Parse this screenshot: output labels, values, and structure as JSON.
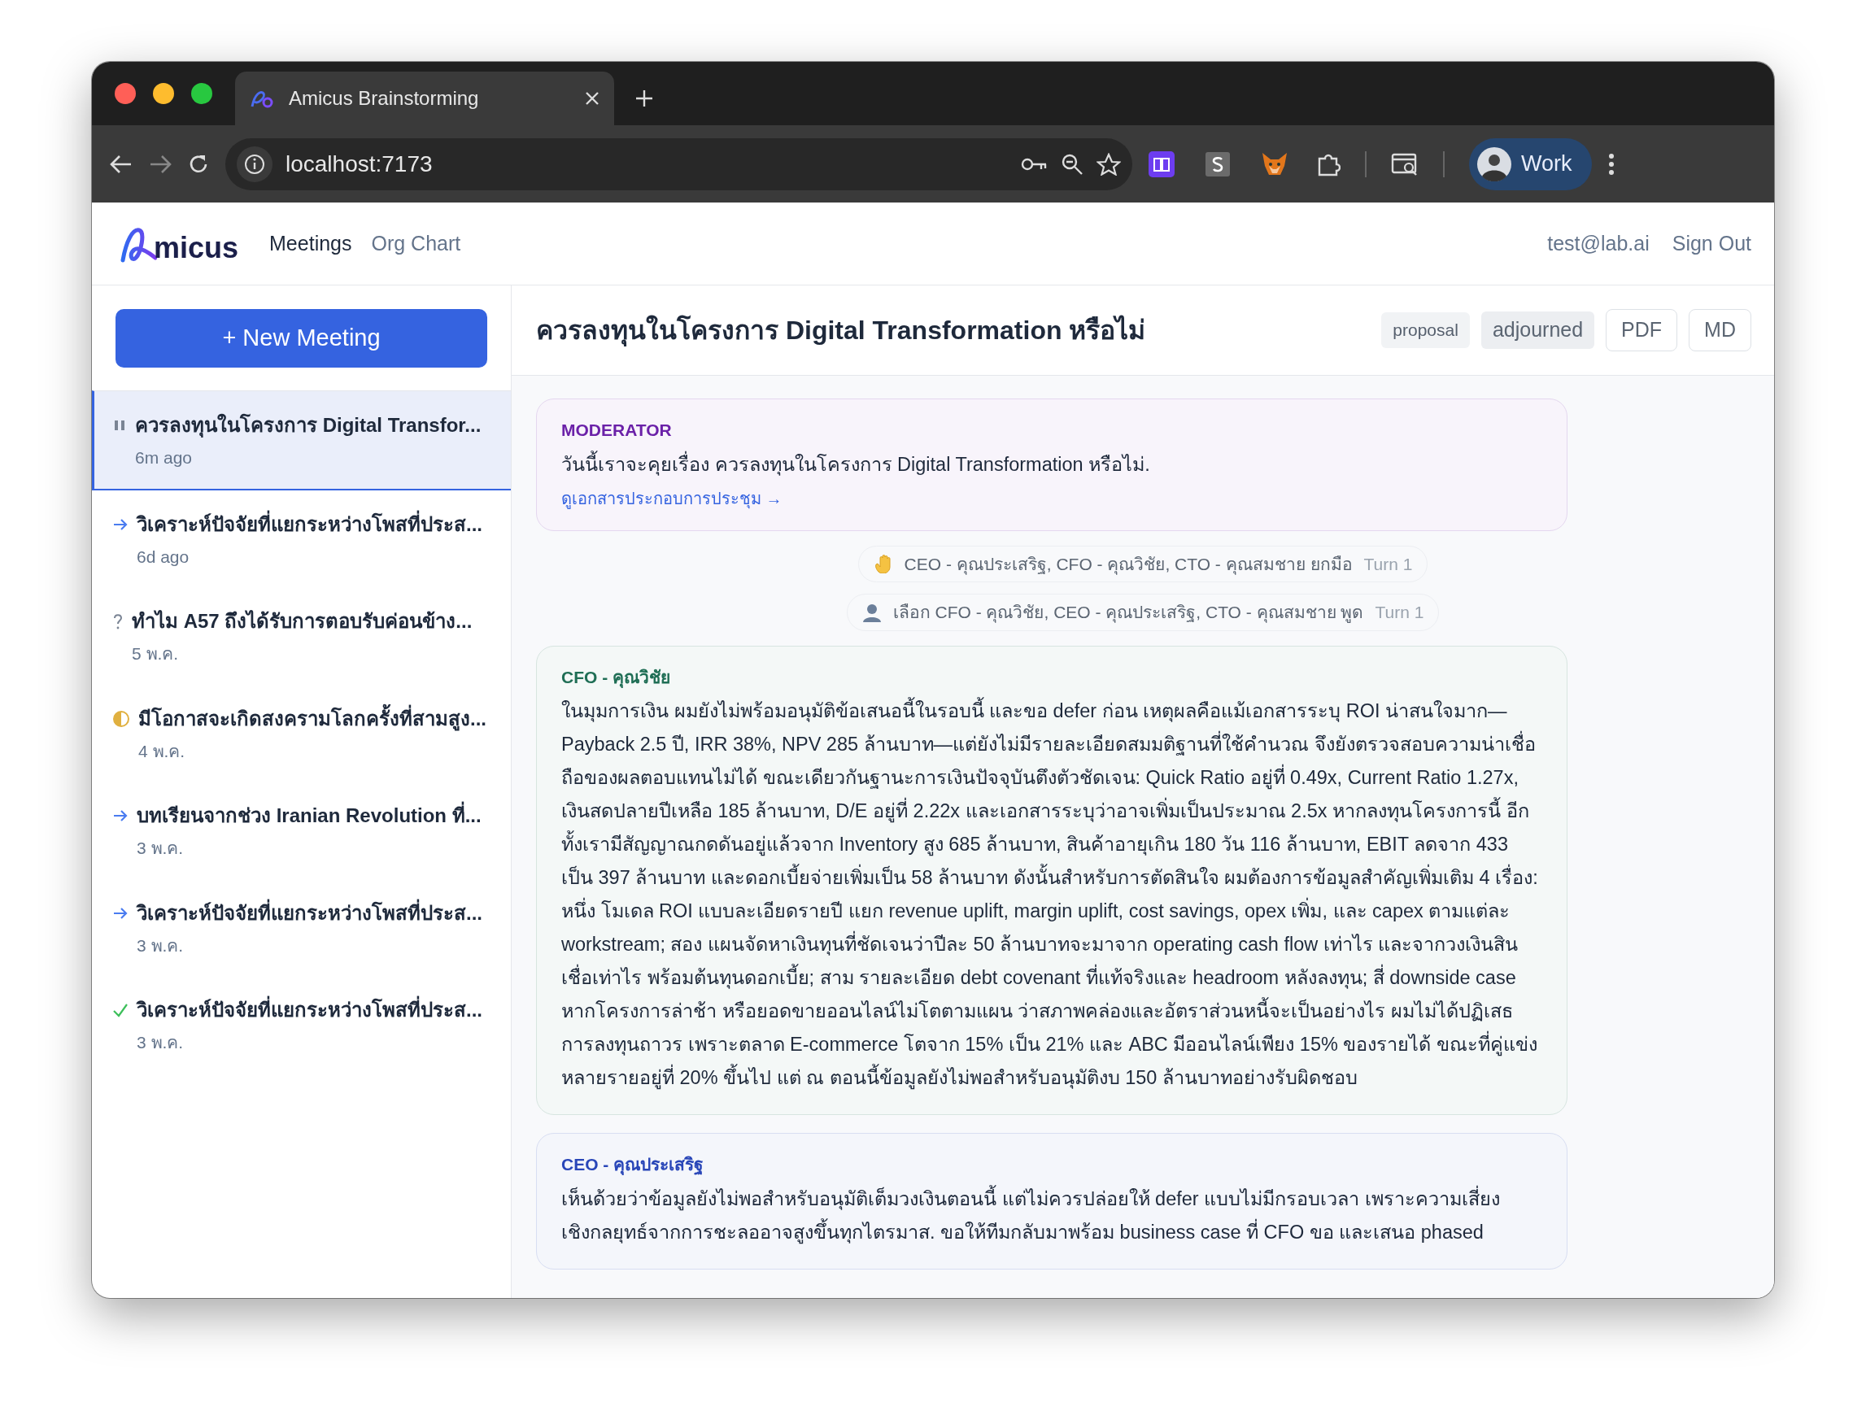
{
  "browser": {
    "tabs": [
      {
        "title": "Amicus Brainstorming",
        "selected": true
      }
    ],
    "url": "localhost:7173",
    "profile": "Work"
  },
  "app": {
    "logo_text": "micus",
    "nav": [
      {
        "label": "Meetings",
        "selected": true
      },
      {
        "label": "Org Chart",
        "selected": false
      }
    ],
    "user": "test@lab.ai",
    "sign_out": "Sign Out"
  },
  "sidebar": {
    "new_button": "+ New Meeting",
    "meetings": [
      {
        "title": "ควรลงทุนในโครงการ Digital Transfor...",
        "time": "6m ago",
        "kind": "paused",
        "selected": true
      },
      {
        "title": "วิเคราะห์ปัจจัยที่แยกระหว่างโพสที่ประส...",
        "time": "6d ago",
        "kind": "running",
        "selected": false
      },
      {
        "title": "ทำไม A57 ถึงได้รับการตอบรับค่อนข้าง...",
        "time": "5 พ.ค.",
        "kind": "question",
        "selected": false
      },
      {
        "title": "มีโอกาสจะเกิดสงครามโลกครั้งที่สามสูง...",
        "time": "4 พ.ค.",
        "kind": "partial",
        "selected": false
      },
      {
        "title": "บทเรียนจากช่วง Iranian Revolution ที่...",
        "time": "3 พ.ค.",
        "kind": "running",
        "selected": false
      },
      {
        "title": "วิเคราะห์ปัจจัยที่แยกระหว่างโพสที่ประส...",
        "time": "3 พ.ค.",
        "kind": "running",
        "selected": false
      },
      {
        "title": "วิเคราะห์ปัจจัยที่แยกระหว่างโพสที่ประส...",
        "time": "3 พ.ค.",
        "kind": "done",
        "selected": false
      }
    ]
  },
  "meeting": {
    "title": "ควรลงทุนในโครงการ Digital Transformation หรือไม่",
    "tags": [
      {
        "label": "proposal",
        "kind": "type"
      },
      {
        "label": "adjourned",
        "kind": "status"
      }
    ],
    "buttons": [
      "PDF",
      "MD"
    ],
    "messages": [
      {
        "kind": "speech",
        "speaker": "MODERATOR",
        "color": "#6b21a8",
        "text": "วันนี้เราจะคุยเรื่อง ควรลงทุนในโครงการ Digital Transformation หรือไม่.",
        "link": "ดูเอกสารประกอบการประชุม →"
      },
      {
        "kind": "hand_raise",
        "text": "CEO - คุณประเสริฐ, CFO - คุณวิชัย, CTO - คุณสมชาย ยกมือ",
        "turn": "Turn 1"
      },
      {
        "kind": "selection",
        "text": "เลือก CFO - คุณวิชัย, CEO - คุณประเสริฐ, CTO - คุณสมชาย พูด",
        "turn": "Turn 1"
      },
      {
        "kind": "speech",
        "speaker": "CFO - คุณวิชัย",
        "color": "#1f6e55",
        "text": "ในมุมการเงิน ผมยังไม่พร้อมอนุมัติข้อเสนอนี้ในรอบนี้ และขอ defer ก่อน เหตุผลคือแม้เอกสารระบุ ROI น่าสนใจมาก—Payback 2.5 ปี, IRR 38%, NPV 285 ล้านบาท—แต่ยังไม่มีรายละเอียดสมมติฐานที่ใช้คำนวณ จึงยังตรวจสอบความน่าเชื่อถือของผลตอบแทนไม่ได้ ขณะเดียวกันฐานะการเงินปัจจุบันตึงตัวชัดเจน: Quick Ratio อยู่ที่ 0.49x, Current Ratio 1.27x, เงินสดปลายปีเหลือ 185 ล้านบาท, D/E อยู่ที่ 2.22x และเอกสารระบุว่าอาจเพิ่มเป็นประมาณ 2.5x หากลงทุนโครงการนี้ อีกทั้งเรามีสัญญาณกดดันอยู่แล้วจาก Inventory สูง 685 ล้านบาท, สินค้าอายุเกิน 180 วัน 116 ล้านบาท, EBIT ลดจาก 433 เป็น 397 ล้านบาท และดอกเบี้ยจ่ายเพิ่มเป็น 58 ล้านบาท ดังนั้นสำหรับการตัดสินใจ ผมต้องการข้อมูลสำคัญเพิ่มเติม 4 เรื่อง: หนึ่ง โมเดล ROI แบบละเอียดรายปี แยก revenue uplift, margin uplift, cost savings, opex เพิ่ม, และ capex ตามแต่ละ workstream; สอง แผนจัดหาเงินทุนที่ชัดเจนว่าปีละ 50 ล้านบาทจะมาจาก operating cash flow เท่าไร และจากวงเงินสินเชื่อเท่าไร พร้อมต้นทุนดอกเบี้ย; สาม รายละเอียด debt covenant ที่แท้จริงและ headroom หลังลงทุน; สี่ downside case หากโครงการล่าช้า หรือยอดขายออนไลน์ไม่โตตามแผน ว่าสภาพคล่องและอัตราส่วนหนี้จะเป็นอย่างไร ผมไม่ได้ปฏิเสธการลงทุนถาวร เพราะตลาด E-commerce โตจาก 15% เป็น 21% และ ABC มีออนไลน์เพียง 15% ของรายได้ ขณะที่คู่แข่งหลายรายอยู่ที่ 20% ขึ้นไป แต่ ณ ตอนนี้ข้อมูลยังไม่พอสำหรับอนุมัติงบ 150 ล้านบาทอย่างรับผิดชอบ"
      },
      {
        "kind": "speech",
        "speaker": "CEO - คุณประเสริฐ",
        "color": "#2946b8",
        "text": "เห็นด้วยว่าข้อมูลยังไม่พอสำหรับอนุมัติเต็มวงเงินตอนนี้ แต่ไม่ควรปล่อยให้ defer แบบไม่มีกรอบเวลา เพราะความเสี่ยงเชิงกลยุทธ์จากการชะลออาจสูงขึ้นทุกไตรมาส. ขอให้ทีมกลับมาพร้อม business case ที่ CFO ขอ และเสนอ phased"
      }
    ]
  }
}
